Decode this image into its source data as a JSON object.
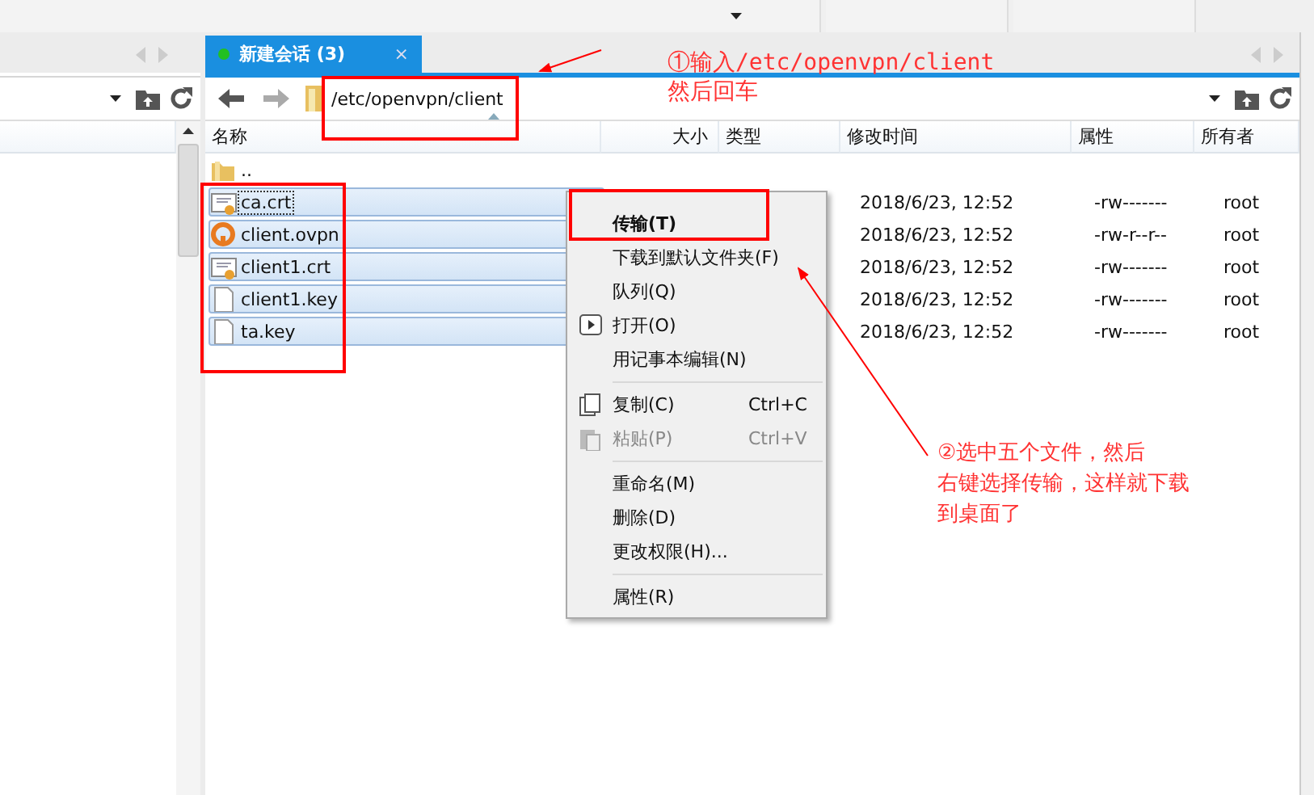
{
  "session_tab": {
    "label": "新建会话 (3)",
    "close": "×",
    "selected": true
  },
  "remote_path": "/etc/openvpn/client",
  "columns": [
    "名称",
    "大小",
    "类型",
    "修改时间",
    "属性",
    "所有者"
  ],
  "rows": [
    {
      "kind": "folder",
      "name": "..",
      "selected": false,
      "modified": "",
      "permissions": "",
      "owner": ""
    },
    {
      "kind": "certificate",
      "name": "ca.crt",
      "selected": true,
      "modified": "2018/6/23, 12:52",
      "permissions": "-rw-------",
      "owner": "root"
    },
    {
      "kind": "openvpn",
      "name": "client.ovpn",
      "selected": true,
      "modified": "2018/6/23, 12:52",
      "permissions": "-rw-r--r--",
      "owner": "root"
    },
    {
      "kind": "certificate",
      "name": "client1.crt",
      "selected": true,
      "modified": "2018/6/23, 12:52",
      "permissions": "-rw-------",
      "owner": "root"
    },
    {
      "kind": "file",
      "name": "client1.key",
      "selected": true,
      "modified": "2018/6/23, 12:52",
      "permissions": "-rw-------",
      "owner": "root"
    },
    {
      "kind": "file",
      "name": "ta.key",
      "selected": true,
      "modified": "2018/6/23, 12:52",
      "permissions": "-rw-------",
      "owner": "root"
    }
  ],
  "context_menu": [
    {
      "kind": "item",
      "label": "传输(T)",
      "bold": true,
      "disabled": false
    },
    {
      "kind": "item",
      "label": "下载到默认文件夹(F)",
      "bold": false,
      "disabled": false
    },
    {
      "kind": "item",
      "label": "队列(Q)",
      "bold": false,
      "disabled": false
    },
    {
      "kind": "item",
      "label": "打开(O)",
      "bold": false,
      "disabled": false
    },
    {
      "kind": "item",
      "label": "用记事本编辑(N)",
      "bold": false,
      "disabled": false
    },
    {
      "kind": "separator"
    },
    {
      "kind": "item",
      "label": "复制(C)",
      "shortcut": "Ctrl+C",
      "bold": false,
      "disabled": false
    },
    {
      "kind": "item",
      "label": "粘贴(P)",
      "shortcut": "Ctrl+V",
      "bold": false,
      "disabled": true
    },
    {
      "kind": "separator"
    },
    {
      "kind": "item",
      "label": "重命名(M)",
      "bold": false,
      "disabled": false
    },
    {
      "kind": "item",
      "label": "删除(D)",
      "bold": false,
      "disabled": false
    },
    {
      "kind": "item",
      "label": "更改权限(H)...",
      "bold": false,
      "disabled": false
    },
    {
      "kind": "separator"
    },
    {
      "kind": "item",
      "label": "属性(R)",
      "bold": false,
      "disabled": false
    }
  ],
  "annotations": [
    {
      "lines": [
        "①输入/etc/openvpn/client",
        "然后回车"
      ]
    },
    {
      "lines": [
        "②选中五个文件，然后",
        "右键选择传输，这样就下载",
        "到桌面了"
      ]
    }
  ]
}
